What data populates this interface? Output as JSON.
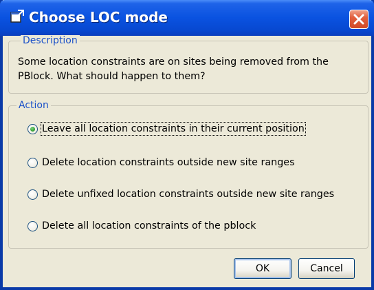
{
  "window": {
    "title": "Choose LOC mode"
  },
  "description": {
    "legend": "Description",
    "text": "Some location constraints are on sites being removed from the PBlock. What should happen to them?"
  },
  "action": {
    "legend": "Action",
    "options": [
      {
        "label": "Leave all location constraints in their current position",
        "selected": true
      },
      {
        "label": "Delete location constraints outside new site ranges",
        "selected": false
      },
      {
        "label": "Delete unfixed location constraints outside new site ranges",
        "selected": false
      },
      {
        "label": "Delete all location constraints of the pblock",
        "selected": false
      }
    ]
  },
  "buttons": {
    "ok_label": "OK",
    "cancel_label": "Cancel"
  },
  "colors": {
    "titlebar": "#0a52e0",
    "legend_text": "#1a50c8",
    "close_button": "#d34a26",
    "dialog_background": "#ece9d8"
  },
  "icons": {
    "app": "app-window-icon",
    "close": "close-icon"
  }
}
